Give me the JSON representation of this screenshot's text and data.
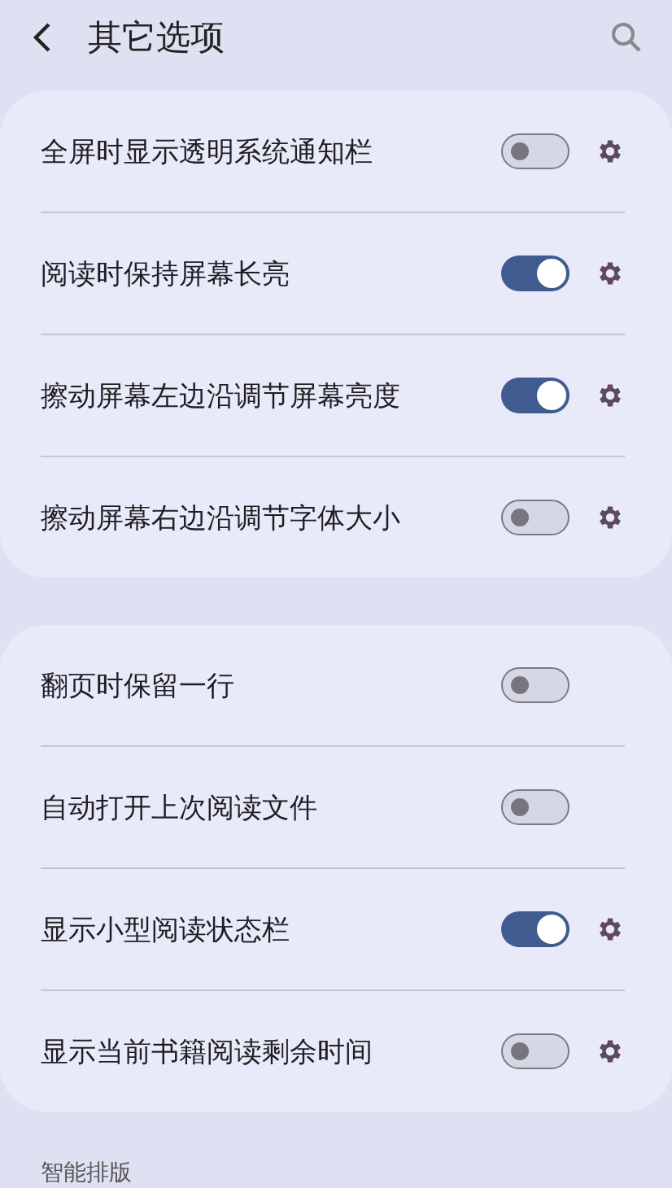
{
  "header": {
    "title": "其它选项"
  },
  "groups": [
    {
      "items": [
        {
          "label": "全屏时显示透明系统通知栏",
          "on": false,
          "settings": true
        },
        {
          "label": "阅读时保持屏幕长亮",
          "on": true,
          "settings": true
        },
        {
          "label": "擦动屏幕左边沿调节屏幕亮度",
          "on": true,
          "settings": true
        },
        {
          "label": "擦动屏幕右边沿调节字体大小",
          "on": false,
          "settings": true
        }
      ]
    },
    {
      "items": [
        {
          "label": "翻页时保留一行",
          "on": false,
          "settings": false
        },
        {
          "label": "自动打开上次阅读文件",
          "on": false,
          "settings": false
        },
        {
          "label": "显示小型阅读状态栏",
          "on": true,
          "settings": true
        },
        {
          "label": "显示当前书籍阅读剩余时间",
          "on": false,
          "settings": true
        }
      ]
    }
  ],
  "next_section": {
    "title": "智能排版"
  }
}
